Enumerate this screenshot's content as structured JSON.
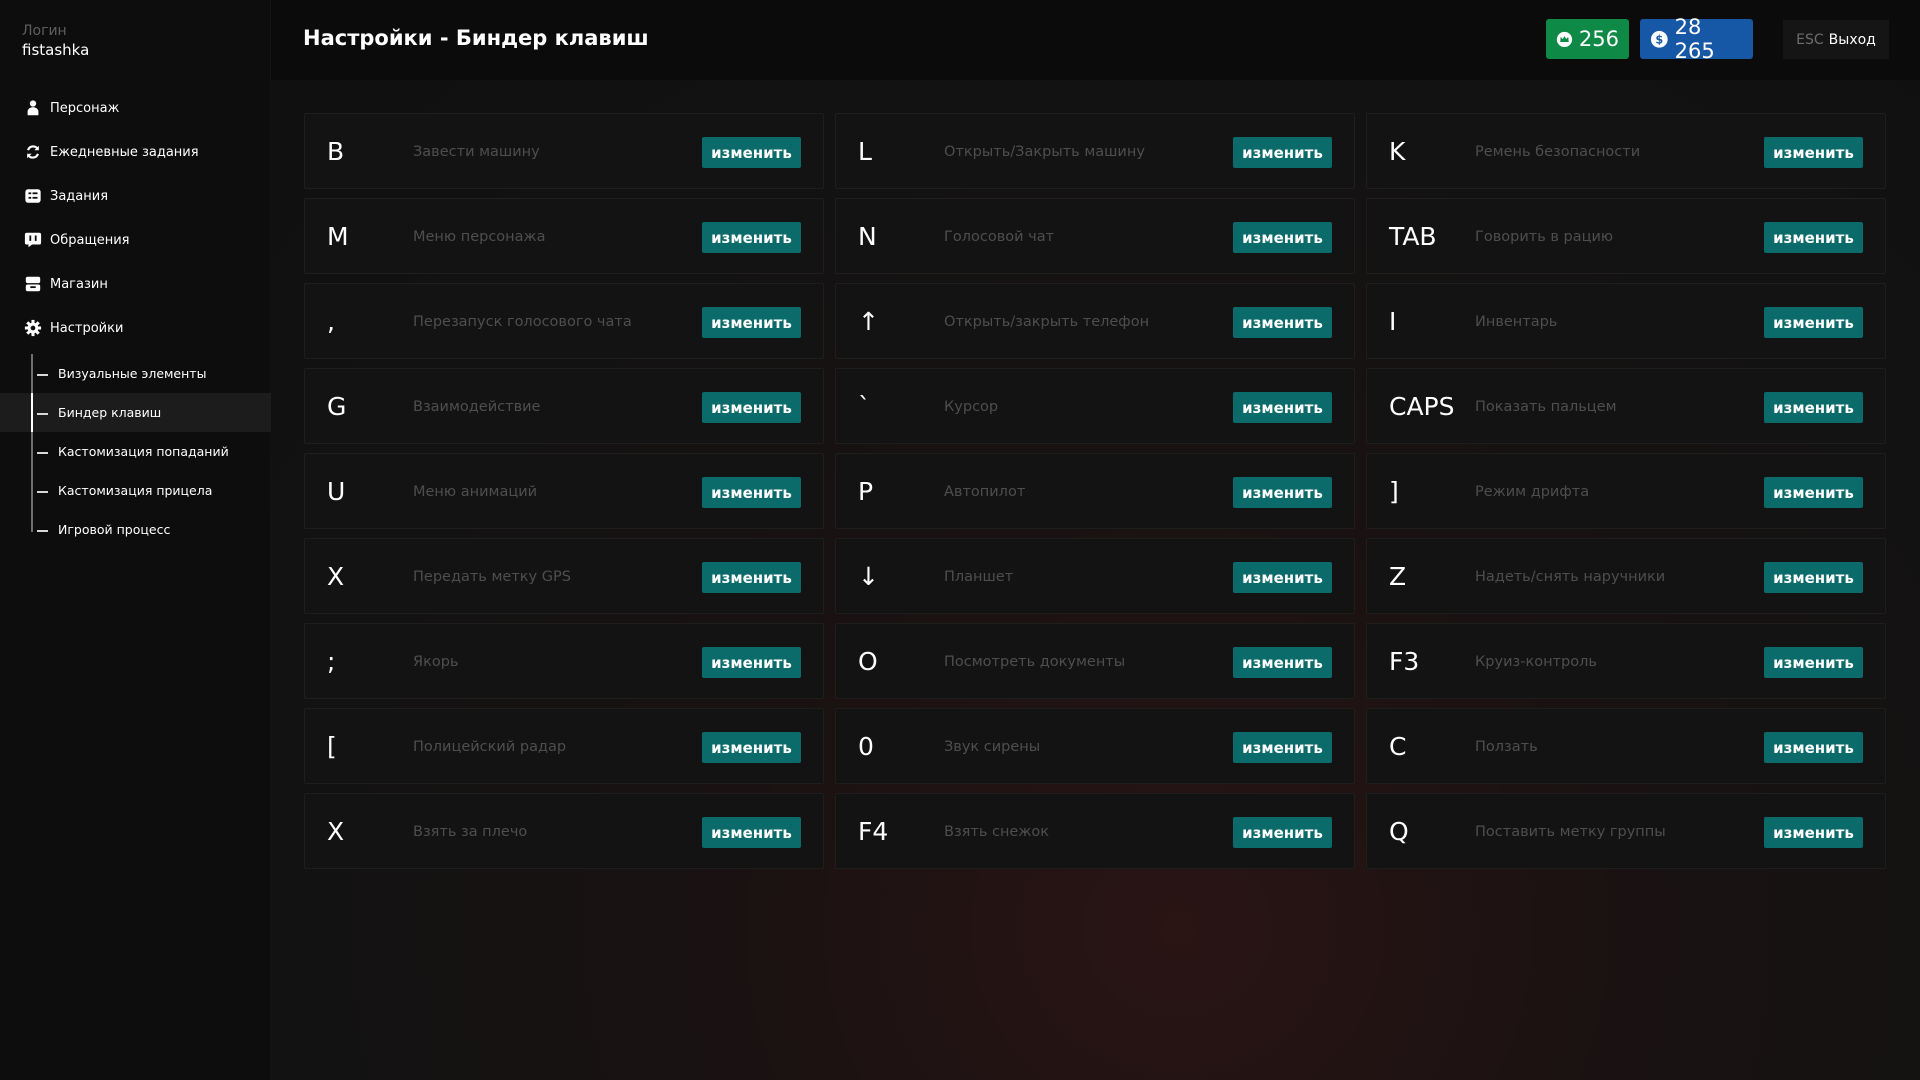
{
  "sidebar": {
    "login_label": "Логин",
    "login_name": "fistashka",
    "items": [
      {
        "label": "Персонаж",
        "icon": "person-icon"
      },
      {
        "label": "Ежедневные задания",
        "icon": "refresh-icon"
      },
      {
        "label": "Задания",
        "icon": "tasks-icon"
      },
      {
        "label": "Обращения",
        "icon": "chat-icon"
      },
      {
        "label": "Магазин",
        "icon": "shop-icon"
      },
      {
        "label": "Настройки",
        "icon": "gear-icon"
      }
    ],
    "subitems": [
      {
        "label": "Визуальные элементы"
      },
      {
        "label": "Биндер клавиш"
      },
      {
        "label": "Кастомизация попаданий"
      },
      {
        "label": "Кастомизация прицела"
      },
      {
        "label": "Игровой процесс"
      }
    ],
    "active_subitem": "Биндер клавиш"
  },
  "header": {
    "title": "Настройки - Биндер клавиш",
    "crowns": "256",
    "coins": "28 265",
    "exit_key": "ESC",
    "exit_label": "Выход"
  },
  "colors": {
    "accent": "#0b6b6a",
    "crowns_bg": "#0f8a46",
    "coins_bg": "#1758a6"
  },
  "button_label": "изменить",
  "bindings": [
    {
      "key": "B",
      "action": "Завести машину"
    },
    {
      "key": "L",
      "action": "Открыть/Закрыть машину"
    },
    {
      "key": "K",
      "action": "Ремень безопасности"
    },
    {
      "key": "M",
      "action": "Меню персонажа"
    },
    {
      "key": "N",
      "action": "Голосовой чат"
    },
    {
      "key": "TAB",
      "action": "Говорить в рацию"
    },
    {
      "key": ",",
      "action": "Перезапуск голосового чата"
    },
    {
      "key": "↑",
      "action": "Открыть/закрыть телефон"
    },
    {
      "key": "I",
      "action": "Инвентарь"
    },
    {
      "key": "G",
      "action": "Взаимодействие"
    },
    {
      "key": "`",
      "action": "Курсор"
    },
    {
      "key": "CAPS",
      "action": "Показать пальцем"
    },
    {
      "key": "U",
      "action": "Меню анимаций"
    },
    {
      "key": "P",
      "action": "Автопилот"
    },
    {
      "key": "]",
      "action": "Режим дрифта"
    },
    {
      "key": "X",
      "action": "Передать метку GPS"
    },
    {
      "key": "↓",
      "action": "Планшет"
    },
    {
      "key": "Z",
      "action": "Надеть/снять наручники"
    },
    {
      "key": ";",
      "action": "Якорь"
    },
    {
      "key": "O",
      "action": "Посмотреть документы"
    },
    {
      "key": "F3",
      "action": "Круиз-контроль"
    },
    {
      "key": "[",
      "action": "Полицейский радар"
    },
    {
      "key": "0",
      "action": "Звук сирены"
    },
    {
      "key": "C",
      "action": "Ползать"
    },
    {
      "key": "X",
      "action": "Взять за плечо"
    },
    {
      "key": "F4",
      "action": "Взять снежок"
    },
    {
      "key": "Q",
      "action": "Поставить метку группы"
    }
  ]
}
